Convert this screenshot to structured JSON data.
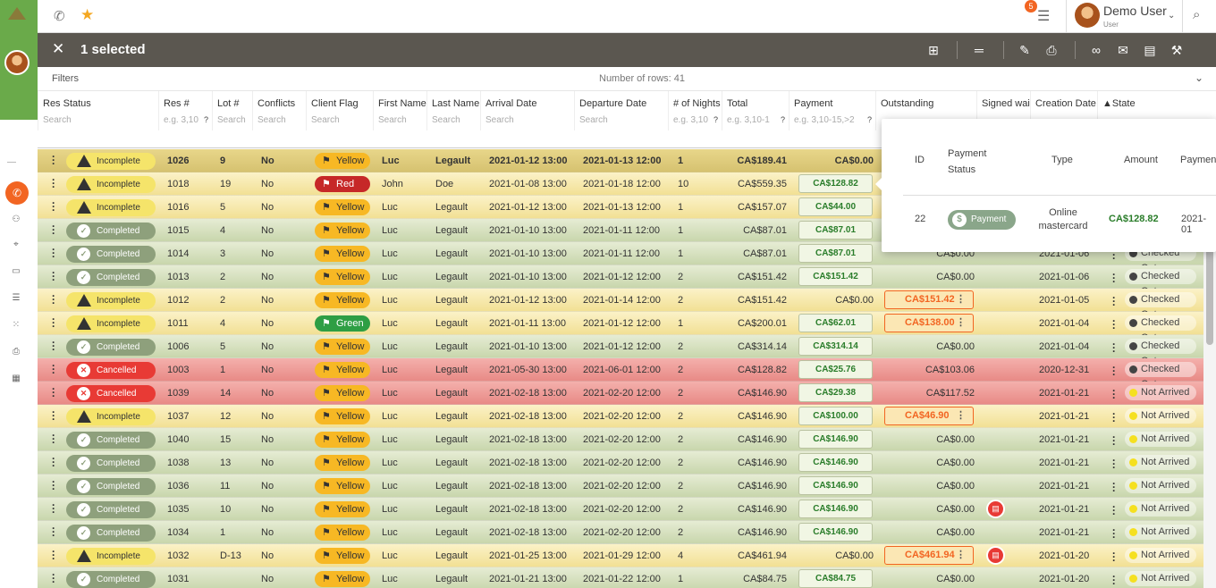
{
  "header": {
    "notification_count": "5",
    "user_name": "Demo User",
    "user_role": "User"
  },
  "toolbar": {
    "selected_label": "1 selected"
  },
  "filters": {
    "label": "Filters",
    "row_count": "Number of rows: 41"
  },
  "columns": [
    {
      "label": "Res Status",
      "placeholder": "Search",
      "q": ""
    },
    {
      "label": "Res #",
      "placeholder": "e.g. 3,10",
      "q": "?"
    },
    {
      "label": "Lot #",
      "placeholder": "Search",
      "q": ""
    },
    {
      "label": "Conflicts",
      "placeholder": "Search",
      "q": ""
    },
    {
      "label": "Client Flag",
      "placeholder": "Search",
      "q": ""
    },
    {
      "label": "First Name",
      "placeholder": "Search",
      "q": ""
    },
    {
      "label": "Last Name",
      "placeholder": "Search",
      "q": ""
    },
    {
      "label": "Arrival Date",
      "placeholder": "Search",
      "q": ""
    },
    {
      "label": "Departure Date",
      "placeholder": "Search",
      "q": ""
    },
    {
      "label": "# of Nights",
      "placeholder": "e.g. 3,10",
      "q": "?"
    },
    {
      "label": "Total",
      "placeholder": "e.g. 3,10-1",
      "q": "?"
    },
    {
      "label": "Payment",
      "placeholder": "e.g. 3,10-15,>2",
      "q": "?"
    },
    {
      "label": "Outstanding",
      "placeholder": "",
      "q": ""
    },
    {
      "label": "Signed wai",
      "placeholder": "",
      "q": ""
    },
    {
      "label": "Creation Date",
      "placeholder": "",
      "q": ""
    },
    {
      "label": "▲State",
      "placeholder": "",
      "q": ""
    }
  ],
  "rows": [
    {
      "rs": "yd",
      "status": "Incomplete",
      "res": "1026",
      "lot": "9",
      "conf": "No",
      "flag": "Yellow",
      "first": "Luc",
      "last": "Legault",
      "arr": "2021-01-12 13:00",
      "dep": "2021-01-13 12:00",
      "nights": "1",
      "total": "CA$189.41",
      "payment": "CA$0.00",
      "pay_box": false,
      "out": "",
      "out_box": false,
      "signed": false,
      "created": "",
      "state": "",
      "state_color": ""
    },
    {
      "rs": "y",
      "status": "Incomplete",
      "res": "1018",
      "lot": "19",
      "conf": "No",
      "flag": "Red",
      "first": "John",
      "last": "Doe",
      "arr": "2021-01-08 13:00",
      "dep": "2021-01-18 12:00",
      "nights": "10",
      "total": "CA$559.35",
      "payment": "CA$128.82",
      "pay_box": true,
      "out": "",
      "out_box": false,
      "signed": false,
      "created": "",
      "state": "",
      "state_color": ""
    },
    {
      "rs": "y",
      "status": "Incomplete",
      "res": "1016",
      "lot": "5",
      "conf": "No",
      "flag": "Yellow",
      "first": "Luc",
      "last": "Legault",
      "arr": "2021-01-12 13:00",
      "dep": "2021-01-13 12:00",
      "nights": "1",
      "total": "CA$157.07",
      "payment": "CA$44.00",
      "pay_box": true,
      "out": "",
      "out_box": false,
      "signed": false,
      "created": "",
      "state": "",
      "state_color": ""
    },
    {
      "rs": "g",
      "status": "Completed",
      "res": "1015",
      "lot": "4",
      "conf": "No",
      "flag": "Yellow",
      "first": "Luc",
      "last": "Legault",
      "arr": "2021-01-10 13:00",
      "dep": "2021-01-11 12:00",
      "nights": "1",
      "total": "CA$87.01",
      "payment": "CA$87.01",
      "pay_box": true,
      "out": "",
      "out_box": false,
      "signed": false,
      "created": "",
      "state": "",
      "state_color": ""
    },
    {
      "rs": "g",
      "status": "Completed",
      "res": "1014",
      "lot": "3",
      "conf": "No",
      "flag": "Yellow",
      "first": "Luc",
      "last": "Legault",
      "arr": "2021-01-10 13:00",
      "dep": "2021-01-11 12:00",
      "nights": "1",
      "total": "CA$87.01",
      "payment": "CA$87.01",
      "pay_box": true,
      "out": "CA$0.00",
      "out_box": false,
      "signed": false,
      "created": "2021-01-06",
      "state": "Checked Out",
      "state_color": "#444444"
    },
    {
      "rs": "g",
      "status": "Completed",
      "res": "1013",
      "lot": "2",
      "conf": "No",
      "flag": "Yellow",
      "first": "Luc",
      "last": "Legault",
      "arr": "2021-01-10 13:00",
      "dep": "2021-01-12 12:00",
      "nights": "2",
      "total": "CA$151.42",
      "payment": "CA$151.42",
      "pay_box": true,
      "out": "CA$0.00",
      "out_box": false,
      "signed": false,
      "created": "2021-01-06",
      "state": "Checked Out",
      "state_color": "#444444"
    },
    {
      "rs": "y",
      "status": "Incomplete",
      "res": "1012",
      "lot": "2",
      "conf": "No",
      "flag": "Yellow",
      "first": "Luc",
      "last": "Legault",
      "arr": "2021-01-12 13:00",
      "dep": "2021-01-14 12:00",
      "nights": "2",
      "total": "CA$151.42",
      "payment": "CA$0.00",
      "pay_box": false,
      "out": "CA$151.42",
      "out_box": true,
      "signed": false,
      "created": "2021-01-05",
      "state": "Checked Out",
      "state_color": "#444444"
    },
    {
      "rs": "y",
      "status": "Incomplete",
      "res": "1011",
      "lot": "4",
      "conf": "No",
      "flag": "Green",
      "first": "Luc",
      "last": "Legault",
      "arr": "2021-01-11 13:00",
      "dep": "2021-01-12 12:00",
      "nights": "1",
      "total": "CA$200.01",
      "payment": "CA$62.01",
      "pay_box": true,
      "out": "CA$138.00",
      "out_box": true,
      "signed": false,
      "created": "2021-01-04",
      "state": "Checked Out",
      "state_color": "#444444"
    },
    {
      "rs": "g",
      "status": "Completed",
      "res": "1006",
      "lot": "5",
      "conf": "No",
      "flag": "Yellow",
      "first": "Luc",
      "last": "Legault",
      "arr": "2021-01-10 13:00",
      "dep": "2021-01-12 12:00",
      "nights": "2",
      "total": "CA$314.14",
      "payment": "CA$314.14",
      "pay_box": true,
      "out": "CA$0.00",
      "out_box": false,
      "signed": false,
      "created": "2021-01-04",
      "state": "Checked Out",
      "state_color": "#444444"
    },
    {
      "rs": "r",
      "status": "Cancelled",
      "res": "1003",
      "lot": "1",
      "conf": "No",
      "flag": "Yellow",
      "first": "Luc",
      "last": "Legault",
      "arr": "2021-05-30 13:00",
      "dep": "2021-06-01 12:00",
      "nights": "2",
      "total": "CA$128.82",
      "payment": "CA$25.76",
      "pay_box": true,
      "out": "CA$103.06",
      "out_box": false,
      "signed": false,
      "created": "2020-12-31",
      "state": "Checked Out",
      "state_color": "#444444"
    },
    {
      "rs": "r",
      "status": "Cancelled",
      "res": "1039",
      "lot": "14",
      "conf": "No",
      "flag": "Yellow",
      "first": "Luc",
      "last": "Legault",
      "arr": "2021-02-18 13:00",
      "dep": "2021-02-20 12:00",
      "nights": "2",
      "total": "CA$146.90",
      "payment": "CA$29.38",
      "pay_box": true,
      "out": "CA$117.52",
      "out_box": false,
      "signed": false,
      "created": "2021-01-21",
      "state": "Not Arrived",
      "state_color": "#f5e020"
    },
    {
      "rs": "y",
      "status": "Incomplete",
      "res": "1037",
      "lot": "12",
      "conf": "No",
      "flag": "Yellow",
      "first": "Luc",
      "last": "Legault",
      "arr": "2021-02-18 13:00",
      "dep": "2021-02-20 12:00",
      "nights": "2",
      "total": "CA$146.90",
      "payment": "CA$100.00",
      "pay_box": true,
      "out": "CA$46.90",
      "out_box": true,
      "signed": false,
      "created": "2021-01-21",
      "state": "Not Arrived",
      "state_color": "#f5e020"
    },
    {
      "rs": "g",
      "status": "Completed",
      "res": "1040",
      "lot": "15",
      "conf": "No",
      "flag": "Yellow",
      "first": "Luc",
      "last": "Legault",
      "arr": "2021-02-18 13:00",
      "dep": "2021-02-20 12:00",
      "nights": "2",
      "total": "CA$146.90",
      "payment": "CA$146.90",
      "pay_box": true,
      "out": "CA$0.00",
      "out_box": false,
      "signed": false,
      "created": "2021-01-21",
      "state": "Not Arrived",
      "state_color": "#f5e020"
    },
    {
      "rs": "g",
      "status": "Completed",
      "res": "1038",
      "lot": "13",
      "conf": "No",
      "flag": "Yellow",
      "first": "Luc",
      "last": "Legault",
      "arr": "2021-02-18 13:00",
      "dep": "2021-02-20 12:00",
      "nights": "2",
      "total": "CA$146.90",
      "payment": "CA$146.90",
      "pay_box": true,
      "out": "CA$0.00",
      "out_box": false,
      "signed": false,
      "created": "2021-01-21",
      "state": "Not Arrived",
      "state_color": "#f5e020"
    },
    {
      "rs": "g",
      "status": "Completed",
      "res": "1036",
      "lot": "11",
      "conf": "No",
      "flag": "Yellow",
      "first": "Luc",
      "last": "Legault",
      "arr": "2021-02-18 13:00",
      "dep": "2021-02-20 12:00",
      "nights": "2",
      "total": "CA$146.90",
      "payment": "CA$146.90",
      "pay_box": true,
      "out": "CA$0.00",
      "out_box": false,
      "signed": false,
      "created": "2021-01-21",
      "state": "Not Arrived",
      "state_color": "#f5e020"
    },
    {
      "rs": "g",
      "status": "Completed",
      "res": "1035",
      "lot": "10",
      "conf": "No",
      "flag": "Yellow",
      "first": "Luc",
      "last": "Legault",
      "arr": "2021-02-18 13:00",
      "dep": "2021-02-20 12:00",
      "nights": "2",
      "total": "CA$146.90",
      "payment": "CA$146.90",
      "pay_box": true,
      "out": "CA$0.00",
      "out_box": false,
      "signed": true,
      "created": "2021-01-21",
      "state": "Not Arrived",
      "state_color": "#f5e020"
    },
    {
      "rs": "g",
      "status": "Completed",
      "res": "1034",
      "lot": "1",
      "conf": "No",
      "flag": "Yellow",
      "first": "Luc",
      "last": "Legault",
      "arr": "2021-02-18 13:00",
      "dep": "2021-02-20 12:00",
      "nights": "2",
      "total": "CA$146.90",
      "payment": "CA$146.90",
      "pay_box": true,
      "out": "CA$0.00",
      "out_box": false,
      "signed": false,
      "created": "2021-01-21",
      "state": "Not Arrived",
      "state_color": "#f5e020"
    },
    {
      "rs": "y",
      "status": "Incomplete",
      "res": "1032",
      "lot": "D-13",
      "conf": "No",
      "flag": "Yellow",
      "first": "Luc",
      "last": "Legault",
      "arr": "2021-01-25 13:00",
      "dep": "2021-01-29 12:00",
      "nights": "4",
      "total": "CA$461.94",
      "payment": "CA$0.00",
      "pay_box": false,
      "out": "CA$461.94",
      "out_box": true,
      "signed": true,
      "created": "2021-01-20",
      "state": "Not Arrived",
      "state_color": "#f5e020"
    },
    {
      "rs": "g",
      "status": "Completed",
      "res": "1031",
      "lot": "",
      "conf": "No",
      "flag": "Yellow",
      "first": "Luc",
      "last": "Legault",
      "arr": "2021-01-21 13:00",
      "dep": "2021-01-22 12:00",
      "nights": "1",
      "total": "CA$84.75",
      "payment": "CA$84.75",
      "pay_box": true,
      "out": "CA$0.00",
      "out_box": false,
      "signed": false,
      "created": "2021-01-20",
      "state": "Not Arrived",
      "state_color": "#f5e020"
    }
  ],
  "popup": {
    "headers": {
      "id": "ID",
      "status": "Payment Status",
      "type": "Type",
      "amount": "Amount",
      "payment": "Paymen"
    },
    "row": {
      "id": "22",
      "status": "Payment",
      "type": "Online mastercard",
      "amount": "CA$128.82",
      "date": "2021-01"
    }
  },
  "colors": {
    "accent": "#f26522",
    "sidebar": "#6aaa4a",
    "toolbar": "#5b5750"
  }
}
